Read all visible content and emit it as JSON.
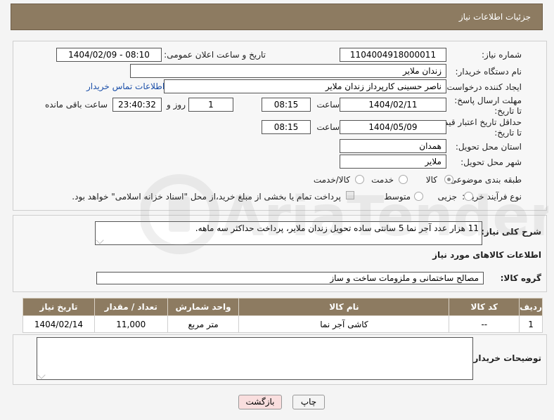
{
  "header": {
    "title": "جزئیات اطلاعات نیاز"
  },
  "form": {
    "need_number_label": "شماره نیاز:",
    "need_number": "1104004918000011",
    "announce_label": "تاریخ و ساعت اعلان عمومی:",
    "announce_value": "1404/02/09 - 08:10",
    "buyer_org_label": "نام دستگاه خریدار:",
    "buyer_org": "زندان ملایر",
    "creator_label": "ایجاد کننده درخواست:",
    "creator": "ناصر  حسینی کارپرداز زندان ملایر",
    "contact_link": "اطلاعات تماس خریدار",
    "reply_deadline_label": "مهلت ارسال پاسخ: تا تاریخ:",
    "reply_date": "1404/02/11",
    "time_label": "ساعت",
    "reply_time": "08:15",
    "days_value": "1",
    "days_label": "روز و",
    "remaining_time": "23:40:32",
    "remaining_label": "ساعت باقی مانده",
    "price_validity_label": "حداقل تاریخ اعتبار قیمت: تا تاریخ:",
    "price_date": "1404/05/09",
    "price_time": "08:15",
    "province_label": "استان محل تحویل:",
    "province": "همدان",
    "city_label": "شهر محل تحویل:",
    "city": "ملایر",
    "category_label": "طبقه بندی موضوعی:",
    "category_options": [
      "کالا",
      "خدمت",
      "کالا/خدمت"
    ],
    "process_label": "نوع فرآیند خرید :",
    "process_options": [
      "جزیی",
      "متوسط"
    ],
    "payment_note": "پرداخت تمام یا بخشی از مبلغ خرید،از محل \"اسناد خزانه اسلامی\" خواهد بود."
  },
  "description": {
    "label": "شرح کلی نیاز:",
    "text": "11 هزار عدد آجر نما 5 سانتی ساده تحویل زندان ملایر، پرداخت حداکثر سه ماهه."
  },
  "goods": {
    "section_title": "اطلاعات کالاهای مورد نیاز",
    "group_label": "گروه کالا:",
    "group_value": "مصالح ساختمانی و ملزومات ساخت و ساز",
    "columns": [
      "ردیف",
      "کد کالا",
      "نام کالا",
      "واحد شمارش",
      "تعداد / مقدار",
      "تاریخ نیاز"
    ],
    "rows": [
      {
        "row": "1",
        "code": "--",
        "name": "کاشی آجر نما",
        "unit": "متر مربع",
        "qty": "11,000",
        "date": "1404/02/14"
      }
    ]
  },
  "buyer_notes": {
    "label": "توضیحات خریدار:"
  },
  "buttons": {
    "print": "چاپ",
    "back": "بازگشت"
  },
  "watermark": {
    "text": "AriaTender.neT"
  },
  "colors": {
    "header": "#8d7b61",
    "back_button": "#f9dede",
    "link": "#1a4ea8"
  }
}
